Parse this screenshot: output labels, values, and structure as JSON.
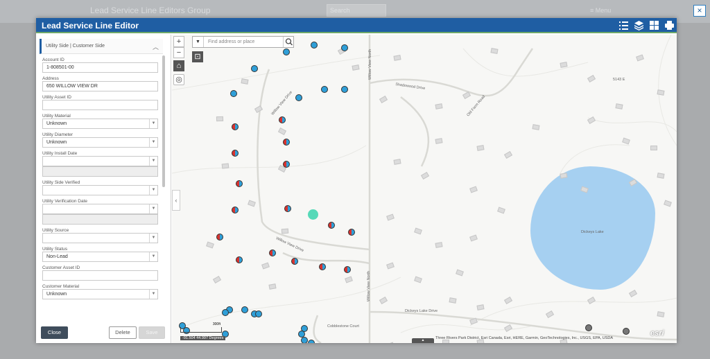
{
  "app": {
    "title": "Lead Service Line Editors Group",
    "search_placeholder": "Search",
    "menu_label": "Menu"
  },
  "close_x": "×",
  "window": {
    "title": "Lead Service Line Editor"
  },
  "header_icons": [
    "list-icon",
    "layers-icon",
    "grid-icon",
    "print-icon"
  ],
  "form": {
    "section_title": "Utility Side | Customer Side",
    "fields": [
      {
        "label": "Account ID",
        "value": "1-808501-00",
        "type": "text"
      },
      {
        "label": "Address",
        "value": "650 WILLOW VIEW DR",
        "type": "text"
      },
      {
        "label": "Utility Asset ID",
        "value": "",
        "type": "text"
      },
      {
        "label": "Utility Material",
        "value": "Unknown",
        "type": "select"
      },
      {
        "label": "Utility Diameter",
        "value": "Unknown",
        "type": "select"
      },
      {
        "label": "Utility Install Date",
        "value": "",
        "type": "date"
      },
      {
        "label": "Utility Side Verified",
        "value": "",
        "type": "select"
      },
      {
        "label": "Utility Verification Date",
        "value": "",
        "type": "date"
      },
      {
        "label": "Utility Source",
        "value": "",
        "type": "select"
      },
      {
        "label": "Utility Status",
        "value": "Non-Lead",
        "type": "select"
      },
      {
        "label": "Customer Asset ID",
        "value": "",
        "type": "text"
      },
      {
        "label": "Customer Material",
        "value": "Unknown",
        "type": "select"
      }
    ]
  },
  "buttons": {
    "close": "Close",
    "delete": "Delete",
    "save": "Save"
  },
  "map": {
    "search_placeholder": "Find address or place",
    "zoom_in": "+",
    "zoom_out": "−",
    "roads": [
      "Willow View Drive",
      "Willow View Drive",
      "Shadowood Drive",
      "Old Farm Road",
      "Willow View North",
      "Willow View North",
      "Dickeys Lake Drive",
      "Cobblestone Court"
    ],
    "lake_label": "Dickeys Lake",
    "house_label": "5143 E",
    "coordinates": "-91.504 44.997 Degrees",
    "scale_label": "300ft",
    "attribution": "Three Rivers Park District, Esri Canada, Esri, HERE, Garmin, GeoTechnologies, Inc., USGS, EPA, USDA",
    "esri_logo": "esri"
  }
}
